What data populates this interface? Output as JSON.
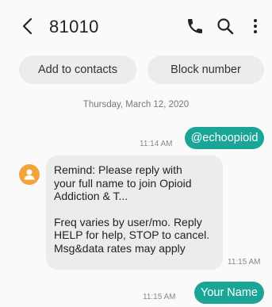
{
  "header": {
    "contact": "81010",
    "back_icon": "chevron-left-icon",
    "call_icon": "phone-icon",
    "search_icon": "search-icon",
    "more_icon": "more-vertical-icon"
  },
  "actions": {
    "add_to_contacts": "Add to contacts",
    "block_number": "Block number"
  },
  "conversation": {
    "date": "Thursday, March 12, 2020",
    "messages": [
      {
        "direction": "outgoing",
        "time": "11:14 AM",
        "text": "@echoopioid"
      },
      {
        "direction": "incoming",
        "time": "11:15 AM",
        "lines": [
          "Remind: Please reply with",
          "your full name to join Opioid",
          "Addiction & T...",
          "",
          "Freq varies by user/mo. Reply",
          "HELP for help, STOP to cancel.",
          "Msg&data rates may apply"
        ]
      },
      {
        "direction": "outgoing",
        "time": "11:15 AM",
        "text": "Your Name"
      }
    ]
  },
  "colors": {
    "outgoing_bubble": "#1aa596",
    "incoming_bubble": "#ececec",
    "avatar": "#f4a33a",
    "background": "#fafafa"
  }
}
